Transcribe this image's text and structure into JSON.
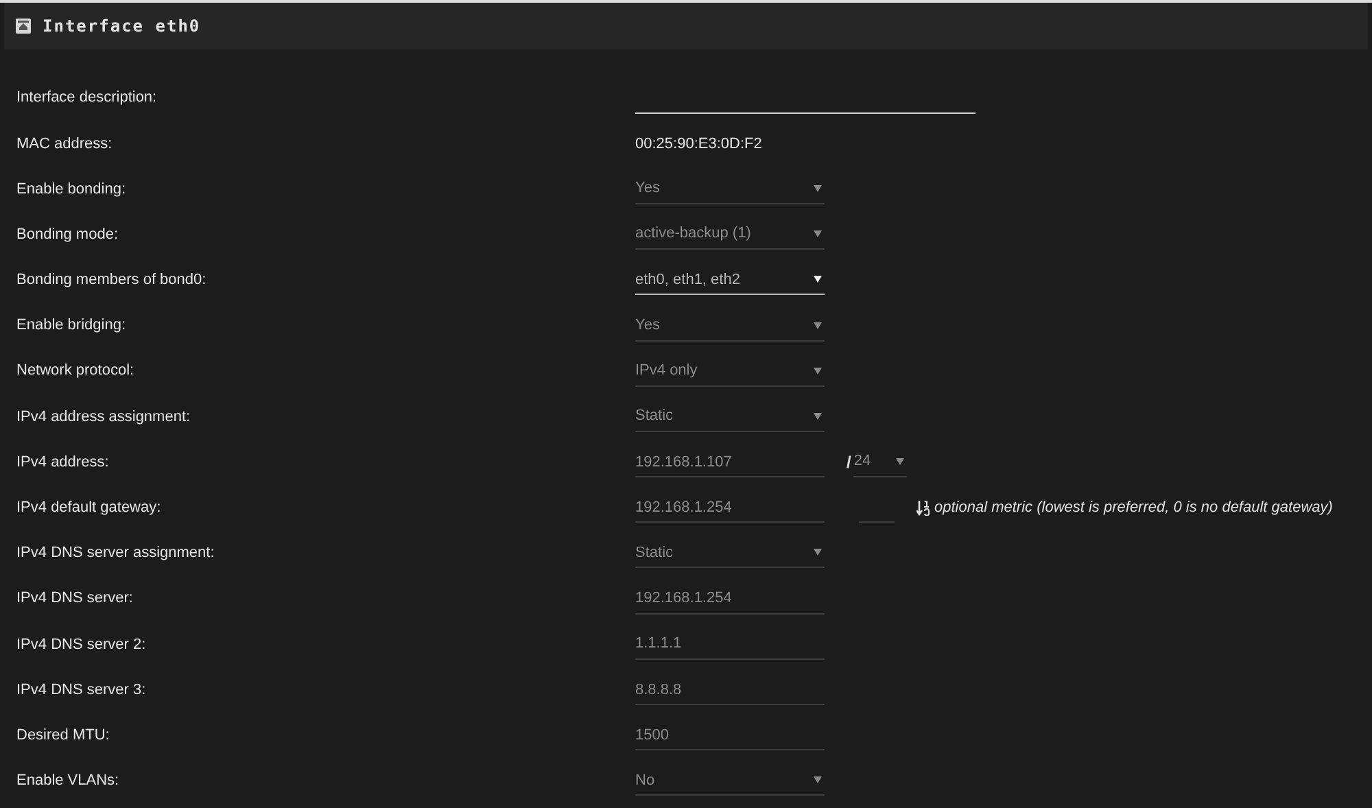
{
  "panel": {
    "title": "Interface eth0"
  },
  "rows": [
    {
      "label": "Interface description:",
      "kind": "text",
      "focused": true
    },
    {
      "label": "MAC address:",
      "kind": "static",
      "value": "00:25:90:E3:0D:F2"
    },
    {
      "label": "Enable bonding:",
      "kind": "select",
      "value": "Yes",
      "focused": false
    },
    {
      "label": "Bonding mode:",
      "kind": "select",
      "value": "active-backup (1)",
      "focused": false
    },
    {
      "label": "Bonding members of bond0:",
      "kind": "select",
      "value": "eth0, eth1, eth2",
      "focused": true
    },
    {
      "label": "Enable bridging:",
      "kind": "select",
      "value": "Yes",
      "focused": false
    },
    {
      "label": "Network protocol:",
      "kind": "select",
      "value": "IPv4 only",
      "focused": false
    },
    {
      "label": "IPv4 address assignment:",
      "kind": "select",
      "value": "Static",
      "focused": false
    },
    {
      "label": "IPv4 address:",
      "kind": "cidr",
      "value": "192.168.1.107",
      "separator": "/",
      "prefix": "24"
    },
    {
      "label": "IPv4 default gateway:",
      "kind": "metric",
      "value": "192.168.1.254",
      "hint": "optional metric (lowest is preferred, 0 is no default gateway)"
    },
    {
      "label": "IPv4 DNS server assignment:",
      "kind": "select",
      "value": "Static",
      "focused": false
    },
    {
      "label": "IPv4 DNS server:",
      "kind": "text",
      "value": "192.168.1.254",
      "focused": false
    },
    {
      "label": "IPv4 DNS server 2:",
      "kind": "text",
      "value": "1.1.1.1",
      "focused": false
    },
    {
      "label": "IPv4 DNS server 3:",
      "kind": "text",
      "value": "8.8.8.8",
      "focused": false
    },
    {
      "label": "Desired MTU:",
      "kind": "text",
      "value": "1500",
      "focused": false
    },
    {
      "label": "Enable VLANs:",
      "kind": "select",
      "value": "No",
      "focused": false
    }
  ]
}
